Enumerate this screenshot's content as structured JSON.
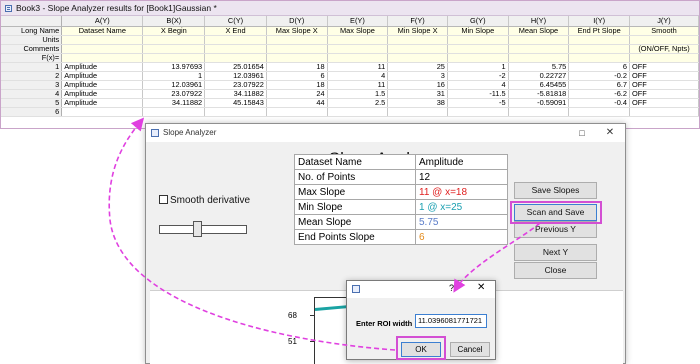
{
  "workbook": {
    "title": "Book3 - Slope Analyzer results for [Book1]Gaussian *",
    "columns": [
      "A(Y)",
      "B(X)",
      "C(Y)",
      "D(Y)",
      "E(Y)",
      "F(Y)",
      "G(Y)",
      "H(Y)",
      "I(Y)",
      "J(Y)"
    ],
    "row_headers": {
      "long_name": "Long Name",
      "units": "Units",
      "comments": "Comments",
      "fx": "F(x)="
    },
    "long_names": [
      "Dataset Name",
      "X Begin",
      "X End",
      "Max Slope X",
      "Max Slope",
      "Min Slope X",
      "Min Slope",
      "Mean Slope",
      "End Pt Slope",
      "Smooth"
    ],
    "comments_j": "(ON/OFF, Npts)",
    "rows": [
      {
        "n": "1",
        "cells": [
          "Amplitude",
          "13.97693",
          "25.01654",
          "18",
          "11",
          "25",
          "1",
          "5.75",
          "6",
          "OFF"
        ]
      },
      {
        "n": "2",
        "cells": [
          "Amplitude",
          "1",
          "12.03961",
          "6",
          "4",
          "3",
          "-2",
          "0.22727",
          "-0.2",
          "OFF"
        ]
      },
      {
        "n": "3",
        "cells": [
          "Amplitude",
          "12.03961",
          "23.07922",
          "18",
          "11",
          "16",
          "4",
          "6.45455",
          "6.7",
          "OFF"
        ]
      },
      {
        "n": "4",
        "cells": [
          "Amplitude",
          "23.07922",
          "34.11882",
          "24",
          "1.5",
          "31",
          "-11.5",
          "-5.81818",
          "-6.2",
          "OFF"
        ]
      },
      {
        "n": "5",
        "cells": [
          "Amplitude",
          "34.11882",
          "45.15843",
          "44",
          "2.5",
          "38",
          "-5",
          "-0.59091",
          "-0.4",
          "OFF"
        ]
      },
      {
        "n": "6",
        "cells": [
          "",
          "",
          "",
          "",
          "",
          "",
          "",
          "",
          "",
          ""
        ]
      }
    ]
  },
  "analyzer": {
    "window_title": "Slope Analyzer",
    "minimize_glyph": "□",
    "close_glyph": "✕",
    "heading": "Slope Analyzer",
    "smooth_label": "Smooth derivative",
    "results": [
      {
        "label": "Dataset Name",
        "value": "Amplitude",
        "color": "#000000"
      },
      {
        "label": "No. of Points",
        "value": "12",
        "color": "#000000"
      },
      {
        "label": "Max Slope",
        "value": "11 @ x=18",
        "color": "#e02020"
      },
      {
        "label": "Min Slope",
        "value": "1 @ x=25",
        "color": "#1a9fb0"
      },
      {
        "label": "Mean Slope",
        "value": "5.75",
        "color": "#5a7cc8"
      },
      {
        "label": "End Points Slope",
        "value": "6",
        "color": "#e38a1a"
      }
    ],
    "buttons": {
      "save": "Save Slopes",
      "scan": "Scan and Save",
      "prev": "Previous Y",
      "next": "Next Y",
      "close": "Close"
    },
    "plot": {
      "ticks": [
        "68",
        "51"
      ]
    }
  },
  "roi_dialog": {
    "help_glyph": "?",
    "close_glyph": "✕",
    "label": "Enter ROI width",
    "value": "11.0396081771721",
    "ok": "OK",
    "cancel": "Cancel"
  },
  "colors": {
    "highlight": "#d34fd3",
    "accent": "#3c7fd1"
  }
}
